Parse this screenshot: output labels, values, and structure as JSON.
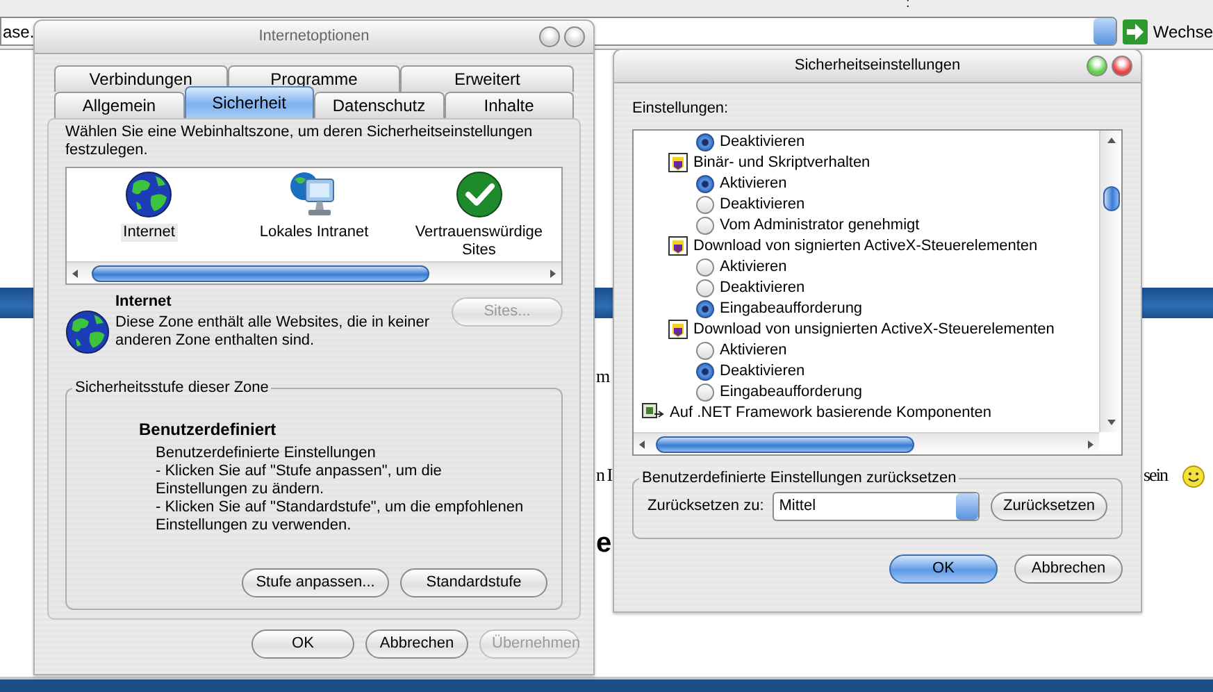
{
  "browser": {
    "top_mark": ":",
    "address": {
      "value": "ase."
    },
    "go_button": {
      "label": "Wechse"
    },
    "page_fragments": [
      {
        "kind": "text",
        "text": "m"
      },
      {
        "kind": "text",
        "text": "n I"
      },
      {
        "kind": "text",
        "text": "sein"
      },
      {
        "kind": "heading",
        "text": "e"
      }
    ]
  },
  "internet_options": {
    "title": "Internetoptionen",
    "tab_rows": [
      [
        {
          "label": "Verbindungen",
          "selected": false
        },
        {
          "label": "Programme",
          "selected": false
        },
        {
          "label": "Erweitert",
          "selected": false
        }
      ],
      [
        {
          "label": "Allgemein",
          "selected": false
        },
        {
          "label": "Sicherheit",
          "selected": true
        },
        {
          "label": "Datenschutz",
          "selected": false
        },
        {
          "label": "Inhalte",
          "selected": false
        }
      ]
    ],
    "intro": "Wählen Sie eine Webinhaltszone, um deren Sicherheitseinstellungen festzulegen.",
    "zones": [
      {
        "kind": "globe",
        "label": "Internet",
        "selected": true
      },
      {
        "kind": "intranet",
        "label": "Lokales Intranet",
        "selected": false
      },
      {
        "kind": "trusted",
        "label": "Vertrauenswürdige Sites",
        "selected": false
      }
    ],
    "zone_info": {
      "name": "Internet",
      "description": "Diese Zone enthält alle Websites, die in keiner anderen Zone enthalten sind.",
      "sites_button": {
        "label": "Sites...",
        "disabled": true
      }
    },
    "level_group": {
      "title": "Sicherheitsstufe dieser Zone",
      "level_name": "Benutzerdefiniert",
      "lines": [
        "Benutzerdefinierte Einstellungen",
        "- Klicken Sie auf \"Stufe anpassen\", um die Einstellungen zu ändern.",
        "- Klicken Sie auf \"Standardstufe\", um die empfohlenen Einstellungen zu verwenden."
      ],
      "buttons": [
        {
          "label": "Stufe anpassen...",
          "disabled": false
        },
        {
          "label": "Standardstufe",
          "disabled": false
        }
      ]
    },
    "buttons": [
      {
        "label": "OK",
        "disabled": false
      },
      {
        "label": "Abbrechen",
        "disabled": false
      },
      {
        "label": "Übernehmen",
        "disabled": true
      }
    ]
  },
  "security_settings": {
    "title": "Sicherheitseinstellungen",
    "list_label": "Einstellungen:",
    "items": [
      {
        "kind": "radio",
        "label": "Deaktivieren",
        "selected": true
      },
      {
        "kind": "category",
        "label": "Binär- und Skriptverhalten",
        "children": [
          {
            "kind": "radio",
            "label": "Aktivieren",
            "selected": true
          },
          {
            "kind": "radio",
            "label": "Deaktivieren",
            "selected": false
          },
          {
            "kind": "radio",
            "label": "Vom Administrator genehmigt",
            "selected": false
          }
        ]
      },
      {
        "kind": "category",
        "label": "Download von signierten ActiveX-Steuerelementen",
        "children": [
          {
            "kind": "radio",
            "label": "Aktivieren",
            "selected": false
          },
          {
            "kind": "radio",
            "label": "Deaktivieren",
            "selected": false
          },
          {
            "kind": "radio",
            "label": "Eingabeaufforderung",
            "selected": true
          }
        ]
      },
      {
        "kind": "category",
        "label": "Download von unsignierten ActiveX-Steuerelementen",
        "children": [
          {
            "kind": "radio",
            "label": "Aktivieren",
            "selected": false
          },
          {
            "kind": "radio",
            "label": "Deaktivieren",
            "selected": true
          },
          {
            "kind": "radio",
            "label": "Eingabeaufforderung",
            "selected": false
          }
        ]
      },
      {
        "kind": "section",
        "label": "Auf .NET Framework basierende Komponenten"
      }
    ],
    "reset_group": {
      "title": "Benutzerdefinierte Einstellungen zurücksetzen",
      "label": "Zurücksetzen zu:",
      "value": "Mittel",
      "button": "Zurücksetzen"
    },
    "buttons": [
      {
        "label": "OK",
        "default": true
      },
      {
        "label": "Abbrechen",
        "default": false
      }
    ]
  }
}
